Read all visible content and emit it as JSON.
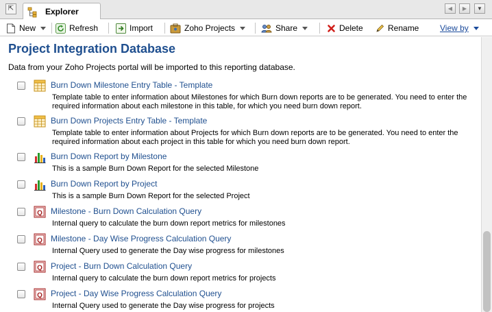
{
  "tab": {
    "label": "Explorer"
  },
  "toolbar": {
    "new": "New",
    "refresh": "Refresh",
    "import": "Import",
    "zoho_projects": "Zoho Projects",
    "share": "Share",
    "delete": "Delete",
    "rename": "Rename",
    "view_by": "View by"
  },
  "header": {
    "title": "Project Integration Database",
    "description": "Data from your Zoho Projects portal will be imported to this reporting database."
  },
  "items": [
    {
      "type": "table",
      "icon": "table-icon",
      "title": "Burn Down Milestone Entry Table - Template",
      "desc": "Template table to enter information about Milestones for which Burn down reports are to be generated. You need to enter the required information about each milestone in this table, for which you need burn down report."
    },
    {
      "type": "table",
      "icon": "table-icon",
      "title": "Burn Down Projects Entry Table - Template",
      "desc": "Template table to enter information about Projects for which Burn down reports are to be generated. You need to enter the required information about each project in this table for which you need burn down report."
    },
    {
      "type": "report",
      "icon": "bar-chart-icon",
      "title": "Burn Down Report by Milestone",
      "desc": "This is a sample Burn Down Report for the selected Milestone"
    },
    {
      "type": "report",
      "icon": "bar-chart-icon",
      "title": "Burn Down Report by Project",
      "desc": "This is a sample Burn Down Report for the selected Project"
    },
    {
      "type": "query",
      "icon": "query-icon",
      "title": "Milestone - Burn Down Calculation Query",
      "desc": "Internal query to calculate the burn down report metrics for milestones"
    },
    {
      "type": "query",
      "icon": "query-icon",
      "title": "Milestone - Day Wise Progress Calculation Query",
      "desc": "Internal Query used to generate the Day wise progress for milestones"
    },
    {
      "type": "query",
      "icon": "query-icon",
      "title": "Project - Burn Down Calculation Query",
      "desc": "Internal query to calculate the burn down report metrics for projects"
    },
    {
      "type": "query",
      "icon": "query-icon",
      "title": "Project - Day Wise Progress Calculation Query",
      "desc": "Internal Query used to generate the Day wise progress for projects"
    }
  ]
}
